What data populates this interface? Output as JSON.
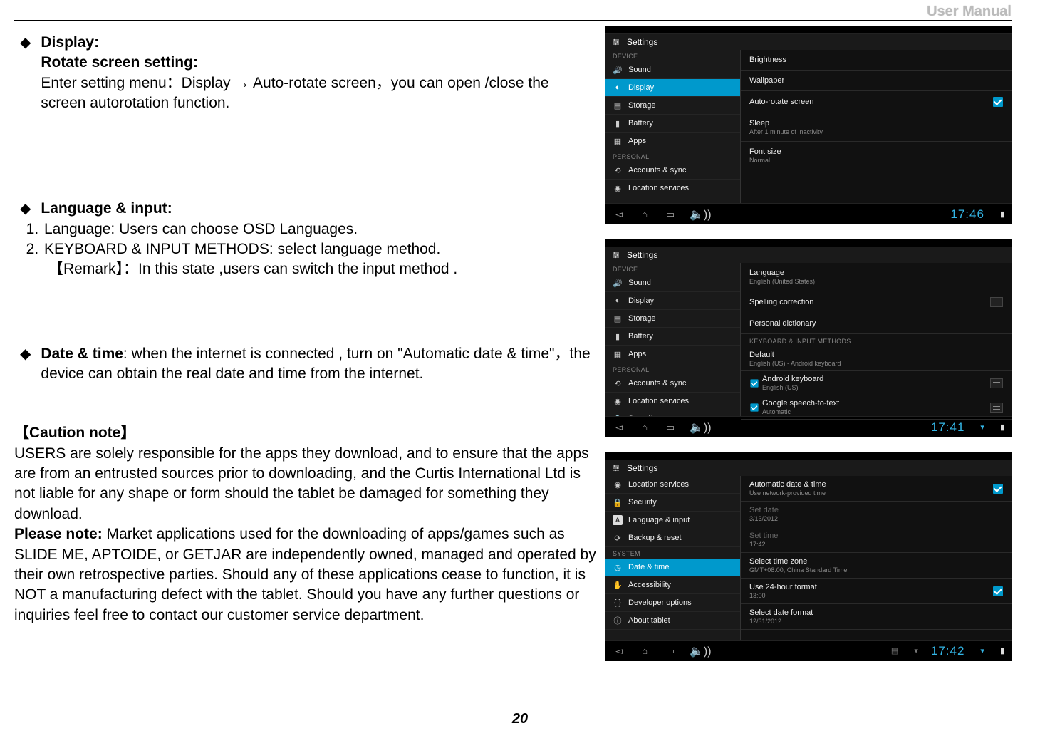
{
  "header": {
    "title": "User Manual"
  },
  "page_number": "20",
  "text": {
    "display": {
      "heading": "Display",
      "rotate_heading": "Rotate screen setting",
      "body_l1": "Enter setting menu：Display → Auto-rotate screen，you can open /close the",
      "body_l2": "screen autorotation function."
    },
    "lang": {
      "heading": "Language & input",
      "li1": "Language: Users can choose OSD Languages.",
      "li2": "KEYBOARD & INPUT METHODS: select language method.",
      "remark": "【Remark】：In this state ,users can switch the input method ."
    },
    "date": {
      "line": "Date & time",
      "body": ": when the internet is connected , turn on \"Automatic date & time\"，the device can obtain the real date and time from the internet."
    },
    "caution": {
      "title": "【Caution note】",
      "p1": "USERS are solely responsible for the apps they download, and to ensure that the apps are from an entrusted sources prior to downloading, and the Curtis International Ltd is not liable for any shape or form should the   tablet be damaged for something they download.",
      "please_note": "Please note:",
      "p2": " Market applications used for the downloading of apps/games such as SLIDE ME, APTOIDE, or GETJAR are independently owned, managed and operated by their own retrospective parties. Should any of these applications cease to function, it is NOT a manufacturing defect with the tablet. Should you have any further questions or inquiries feel free to contact our customer service department."
    }
  },
  "shot1": {
    "title": "Settings",
    "sidebar": {
      "hdr1": "DEVICE",
      "items1": [
        "Sound",
        "Display",
        "Storage",
        "Battery",
        "Apps"
      ],
      "hdr2": "PERSONAL",
      "items2": [
        "Accounts & sync",
        "Location services"
      ]
    },
    "main": {
      "brightness": "Brightness",
      "wallpaper": "Wallpaper",
      "autorotate": "Auto-rotate screen",
      "sleep": "Sleep",
      "sleep_sub": "After 1 minute of inactivity",
      "font": "Font size",
      "font_sub": "Normal"
    },
    "clock": "17:46"
  },
  "shot2": {
    "title": "Settings",
    "sidebar": {
      "hdr1": "DEVICE",
      "items1": [
        "Sound",
        "Display",
        "Storage",
        "Battery",
        "Apps"
      ],
      "hdr2": "PERSONAL",
      "items2": [
        "Accounts & sync",
        "Location services",
        "Security"
      ]
    },
    "main": {
      "language": "Language",
      "language_sub": "English (United States)",
      "spelling": "Spelling correction",
      "dict": "Personal dictionary",
      "hdr": "KEYBOARD & INPUT METHODS",
      "default": "Default",
      "default_sub": "English (US) - Android keyboard",
      "android_kb": "Android keyboard",
      "android_kb_sub": "English (US)",
      "google": "Google speech-to-text",
      "google_sub": "Automatic"
    },
    "clock": "17:41"
  },
  "shot3": {
    "title": "Settings",
    "sidebar": {
      "items1": [
        "Location services",
        "Security",
        "Language & input",
        "Backup & reset"
      ],
      "hdr2": "SYSTEM",
      "items2": [
        "Date & time",
        "Accessibility",
        "Developer options",
        "About tablet"
      ]
    },
    "main": {
      "auto_dt": "Automatic date & time",
      "auto_dt_sub": "Use network-provided time",
      "set_date": "Set date",
      "set_date_sub": "3/13/2012",
      "set_time": "Set time",
      "set_time_sub": "17:42",
      "tz": "Select time zone",
      "tz_sub": "GMT+08:00, China Standard Time",
      "format24": "Use 24-hour format",
      "format24_sub": "13:00",
      "date_fmt": "Select date format",
      "date_fmt_sub": "12/31/2012"
    },
    "clock": "17:42"
  }
}
